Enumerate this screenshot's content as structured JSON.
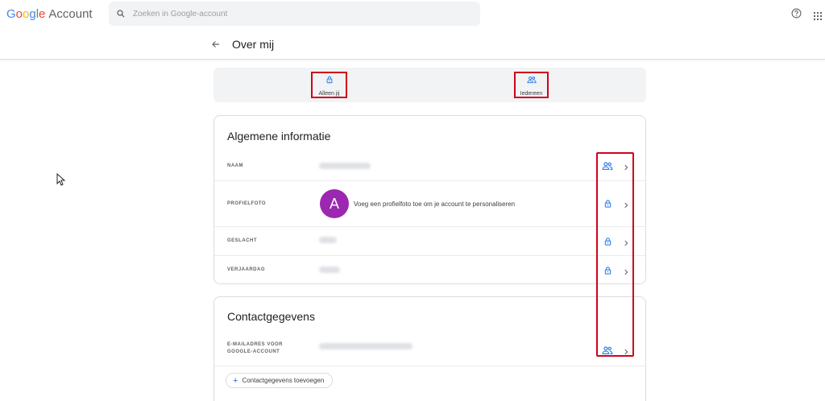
{
  "header": {
    "logo_letters": [
      "G",
      "o",
      "o",
      "g",
      "l",
      "e"
    ],
    "logo_suffix": "Account",
    "search_placeholder": "Zoeken in Google-account",
    "help_icon": "help-icon",
    "apps_icon": "apps-grid-icon"
  },
  "page": {
    "title": "Over mij",
    "back_icon": "arrow-back-icon"
  },
  "legend": {
    "only_you": "Alleen jij",
    "everyone": "Iedereen"
  },
  "general": {
    "title": "Algemene informatie",
    "rows": [
      {
        "label": "NAAM",
        "visibility": "everyone"
      },
      {
        "label": "PROFIELFOTO",
        "visibility": "only_you",
        "avatar_letter": "A",
        "text": "Voeg een profielfoto toe om je account te personaliseren"
      },
      {
        "label": "GESLACHT",
        "visibility": "only_you"
      },
      {
        "label": "VERJAARDAG",
        "visibility": "only_you"
      }
    ]
  },
  "contact": {
    "title": "Contactgegevens",
    "email_label_line1": "E-MAILADRES VOOR",
    "email_label_line2": "GOOGLE-ACCOUNT",
    "add_button": "Contactgegevens toevoegen"
  },
  "colors": {
    "accent": "#1a73e8",
    "highlight": "#d0021b",
    "avatar": "#9c27b0"
  }
}
